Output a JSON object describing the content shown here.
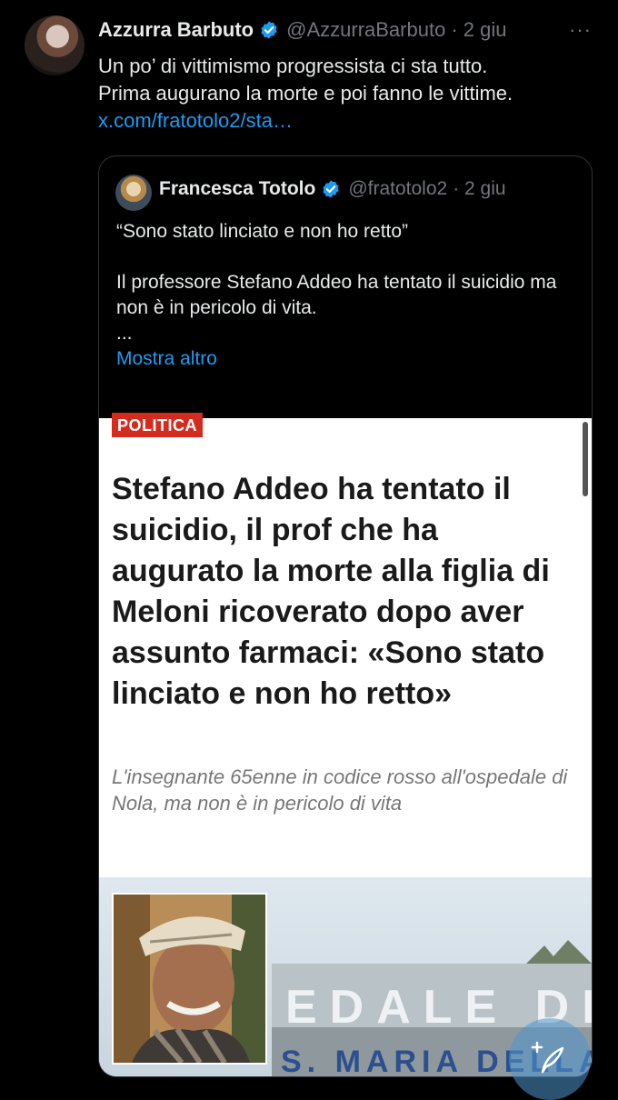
{
  "tweet": {
    "author_name": "Azzurra Barbuto",
    "author_handle": "@AzzurraBarbuto",
    "time": "· 2 giu",
    "more_icon": "···",
    "text_line1": "Un po’ di vittimismo progressista ci sta tutto.",
    "text_line2": "Prima augurano la morte e poi fanno le vittime.",
    "link": "x.com/fratotolo2/sta…"
  },
  "quote": {
    "author_name": "Francesca Totolo",
    "author_handle": "@fratotolo2",
    "time": "· 2 giu",
    "line1": "“Sono stato linciato e non ho retto”",
    "line2": "Il professore Stefano Addeo ha tentato il suicidio ma non è in pericolo di vita.",
    "ellipsis": "...",
    "show_more": "Mostra altro"
  },
  "article": {
    "section": "POLITICA",
    "headline": "Stefano Addeo ha tentato il suicidio, il prof che ha augurato la morte alla figlia di Meloni ricoverato dopo aver assunto farmaci: «Sono stato linciato e non ho retto»",
    "subheadline": "L'insegnante 65enne in codice rosso all'ospedale di Nola, ma non è in pericolo di vita",
    "sign_text_line1": "EDALE DI",
    "sign_text_line2": "S. MARIA DELLA P"
  },
  "colors": {
    "accent": "#1d9bf0",
    "verified": "#1d9bf0",
    "badge": "#d42b1f",
    "muted": "#71767b"
  },
  "icons": [
    "verified-badge-icon",
    "more-options-icon",
    "compose-post-icon"
  ]
}
